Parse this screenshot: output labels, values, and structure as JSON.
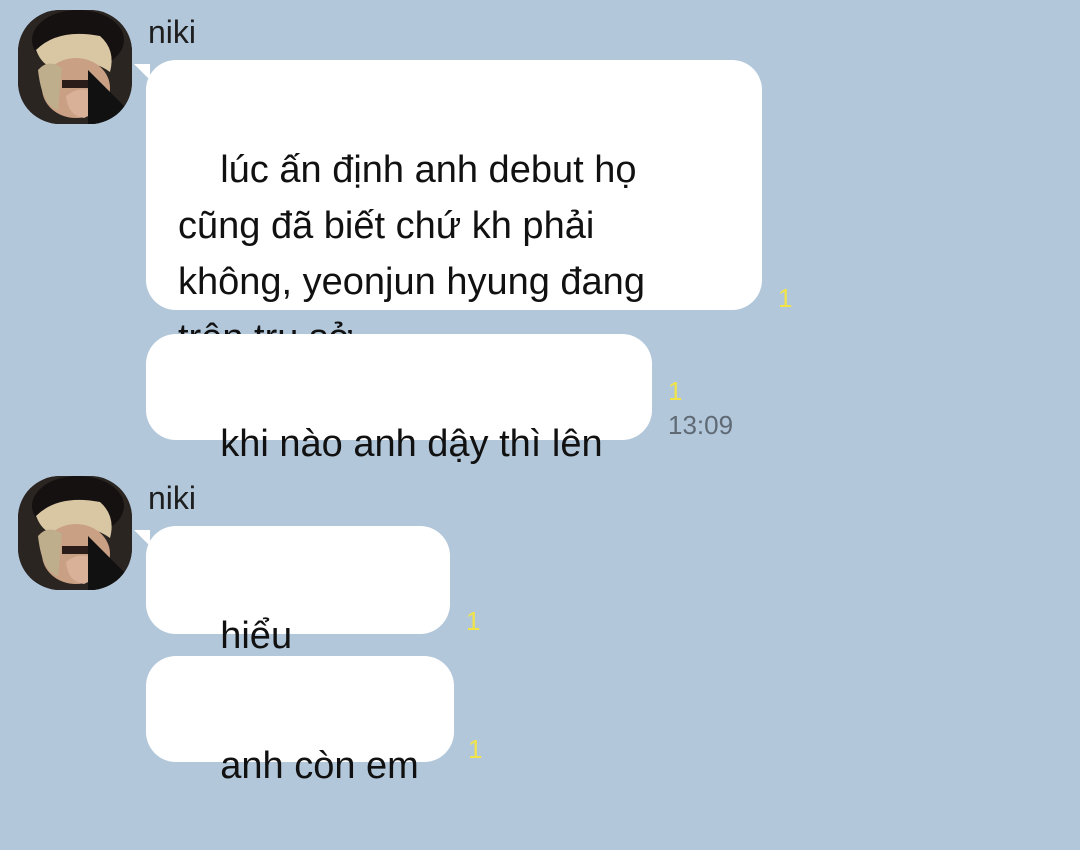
{
  "messages_group_1": {
    "sender_name": "niki",
    "bubble_1": {
      "text": "lúc ấn định anh debut họ\ncũng đã biết chứ kh phải\nkhông, yeonjun hyung đang\ntrên trụ sở",
      "unread_count": "1"
    },
    "bubble_2": {
      "text": "khi nào anh dậy thì lên",
      "unread_count": "1",
      "time": "13:09"
    }
  },
  "messages_group_2": {
    "sender_name": "niki",
    "bubble_1": {
      "text": "hiểu không?",
      "unread_count": "1"
    },
    "bubble_2": {
      "text": "anh còn em",
      "unread_count": "1"
    }
  },
  "colors": {
    "background": "#b2c7da",
    "bubble": "#ffffff",
    "unread": "#f0e44a",
    "timestamp": "#5f6a75"
  }
}
